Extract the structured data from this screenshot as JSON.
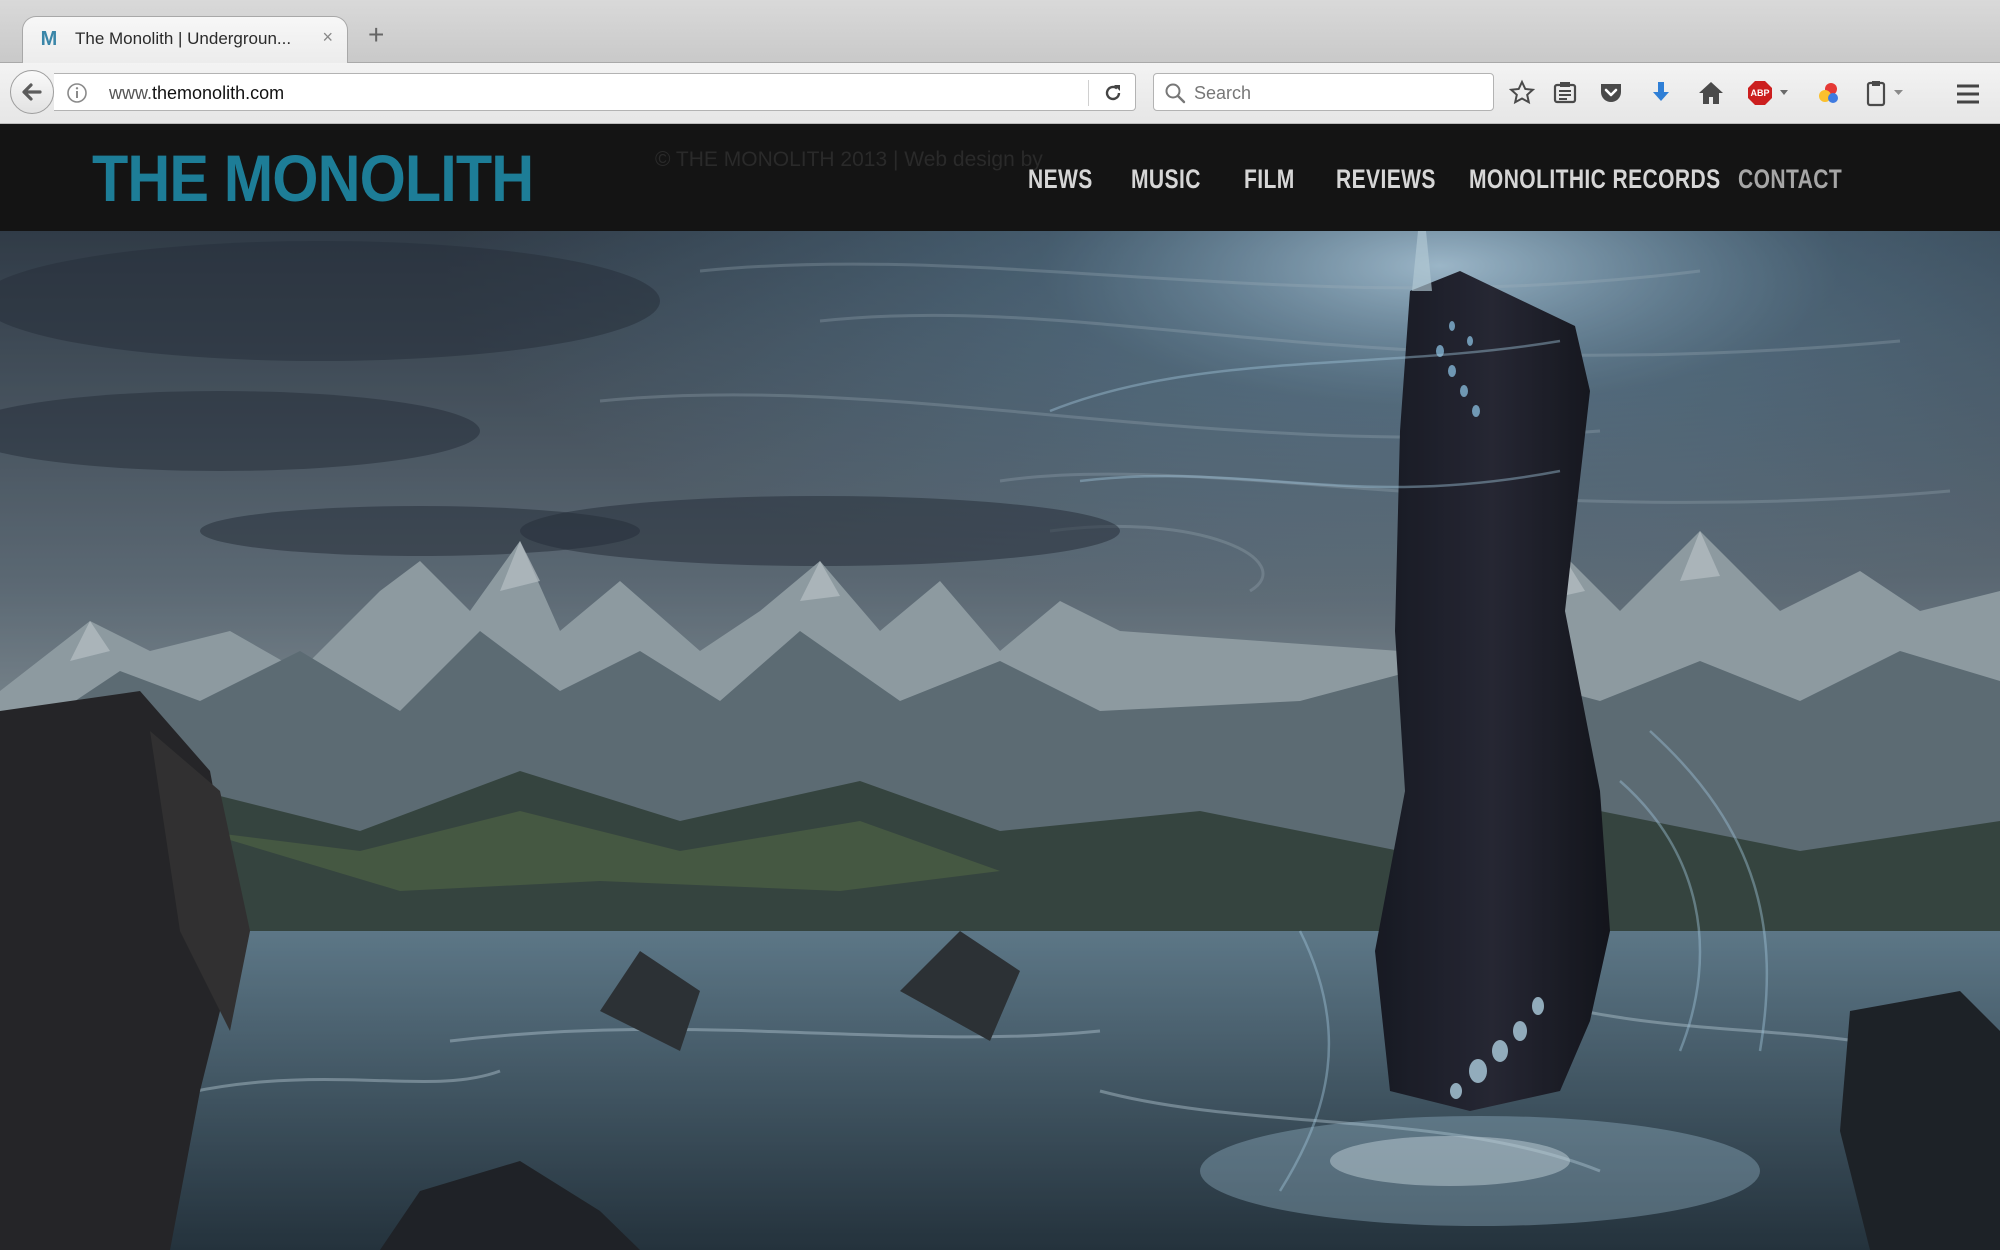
{
  "browser": {
    "tab": {
      "title": "The Monolith | Undergroun...",
      "favicon": "M",
      "close_label": "×"
    },
    "new_tab_label": "+",
    "address": {
      "prefix": "www.",
      "domain": "themonolith.com"
    },
    "search": {
      "placeholder": "Search"
    },
    "toolbar_icons": [
      "star-icon",
      "reading-list-icon",
      "pocket-icon",
      "download-icon",
      "home-icon",
      "adblock-icon",
      "extension-icon",
      "clipboard-icon",
      "menu-icon"
    ],
    "adblock_label": "ABP"
  },
  "site": {
    "logo": "THE MONOLITH",
    "ghost_text": "© THE MONOLITH 2013 | Web design by",
    "nav": [
      "NEWS",
      "MUSIC",
      "FILM",
      "REVIEWS",
      "MONOLITHIC RECORDS",
      "CONTACT"
    ],
    "colors": {
      "brand": "#1d7d97",
      "header_bg": "#141414",
      "nav_text": "#d6d6d6"
    }
  }
}
